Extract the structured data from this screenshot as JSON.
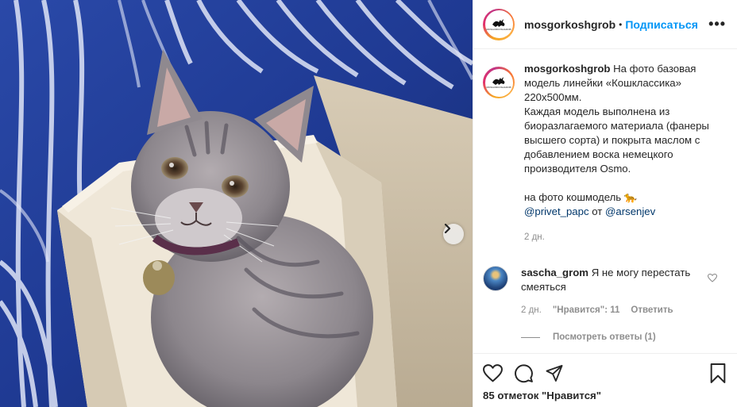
{
  "header": {
    "username": "mosgorkoshgrob",
    "separator": "•",
    "follow_label": "Подписаться",
    "more_label": "•••",
    "avatar_logo_text": "MOSGORKOSHGROB"
  },
  "caption": {
    "username": "mosgorkoshgrob",
    "line1": "На фото базовая модель линейки «Кошклассика» 220х500мм.",
    "line2": "Каждая модель выполнена из биоразлагаемого материала (фанеры высшего сорта) и покрыта маслом с добавлением воска немецкого производителя Osmo.",
    "line3": "на фото кошмодель 🐆",
    "mention1": "@privet_papc",
    "from_word": " от ",
    "mention2": "@arsenjev",
    "time": "2 дн."
  },
  "comment": {
    "username": "sascha_grom",
    "text": "Я не могу перестать смеяться",
    "time": "2 дн.",
    "likes": "\"Нравится\": 11",
    "reply_label": "Ответить",
    "view_replies": "Посмотреть ответы (1)"
  },
  "footer": {
    "likes": "85 отметок \"Нравится\""
  },
  "icons": {
    "like": "heart-icon",
    "comment": "comment-icon",
    "share": "share-icon",
    "save": "bookmark-icon",
    "next": "chevron-right-icon"
  },
  "colors": {
    "link": "#0095f6",
    "mention": "#00376b",
    "meta": "#8e8e8e",
    "text": "#262626"
  }
}
